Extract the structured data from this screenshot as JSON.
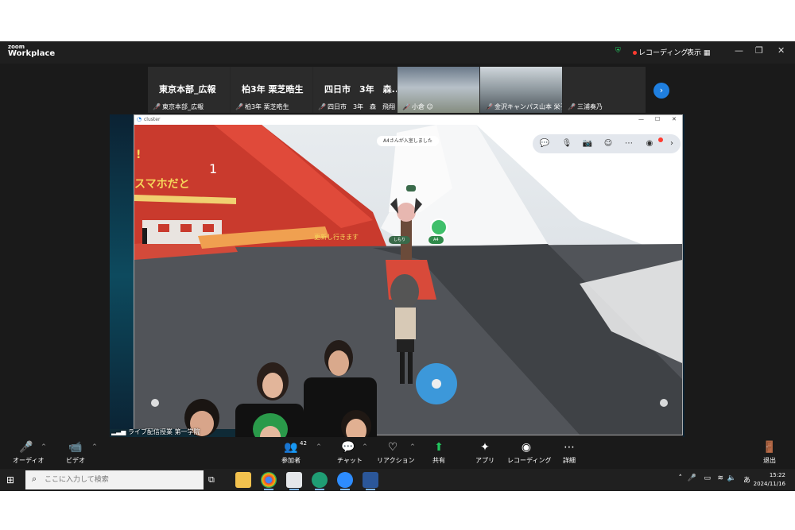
{
  "zoom": {
    "logo_top": "zoom",
    "logo_bottom": "Workplace",
    "recording_label": "レコーディング",
    "view_label": "表示"
  },
  "strip": {
    "tiles": [
      {
        "big": "東京本部_広報",
        "name": "東京本部_広報"
      },
      {
        "big": "柏3年 栗芝晧生",
        "name": "柏3年 栗芝晧生"
      },
      {
        "big": "四日市　3年　森...",
        "name": "四日市　3年　森　飛翔"
      },
      {
        "big": "",
        "name": "小倉 ☺"
      },
      {
        "big": "",
        "name": "金沢キャンパス山本 栄子"
      },
      {
        "big": "",
        "name": "三浦奏乃"
      }
    ]
  },
  "cluster": {
    "title": "cluster",
    "toast": "A4さんが入室しました",
    "nameplates": [
      "しもり",
      "A4"
    ],
    "scene_text": {
      "sign_1": "スマホだと",
      "sign_2": "1",
      "sign_3": "!",
      "sign_4": "更新し行きます"
    }
  },
  "overlay": {
    "live_label": "ライブ配信授業 第一学院"
  },
  "toolbar": {
    "audio": "オーディオ",
    "video": "ビデオ",
    "participants": "参加者",
    "participants_count": "42",
    "chat": "チャット",
    "reaction": "リアクション",
    "share": "共有",
    "apps": "アプリ",
    "record": "レコーディング",
    "more": "詳細",
    "leave": "退出"
  },
  "taskbar": {
    "search_placeholder": "ここに入力して検索",
    "ime": "あ",
    "time": "15:22",
    "date": "2024/11/16"
  },
  "colors": {
    "zoom_blue": "#1f7fe0",
    "muted_red": "#e5484d",
    "share_green": "#22c55e",
    "recording_red": "#ff3b30"
  }
}
